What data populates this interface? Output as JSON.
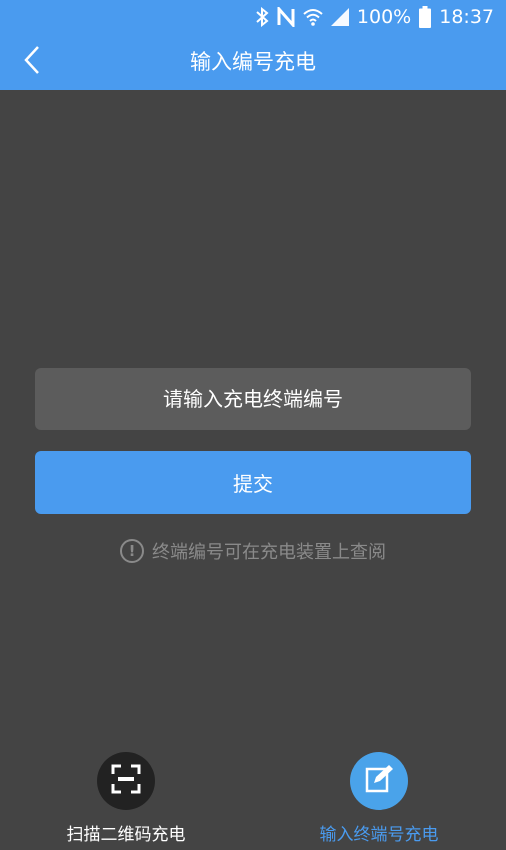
{
  "status_bar": {
    "battery_text": "100%",
    "time": "18:37",
    "icons": [
      "bluetooth-icon",
      "nfc-icon",
      "wifi-icon",
      "signal-icon",
      "battery-icon"
    ]
  },
  "nav": {
    "title": "输入编号充电",
    "back_icon": "chevron-left-icon"
  },
  "form": {
    "input_placeholder": "请输入充电终端编号",
    "input_value": "",
    "submit_label": "提交",
    "hint_text": "终端编号可在充电装置上查阅",
    "hint_icon": "info-icon"
  },
  "bottom_tabs": [
    {
      "label": "扫描二维码充电",
      "icon": "qr-scan-icon",
      "active": false
    },
    {
      "label": "输入终端号充电",
      "icon": "edit-icon",
      "active": true
    }
  ],
  "colors": {
    "accent": "#4a9bef",
    "background": "#444444",
    "input_bg": "#5c5c5c",
    "hint": "#8a8a8a",
    "tab_active_circle": "#4aa3ea",
    "tab_inactive_circle": "#222222"
  }
}
